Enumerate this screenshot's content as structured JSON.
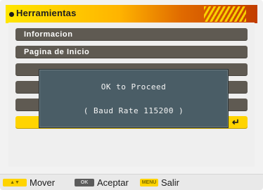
{
  "header": {
    "title": "Herramientas"
  },
  "menu": {
    "items": [
      {
        "label": "Informacion",
        "selected": false
      },
      {
        "label": "Pagina de Inicio",
        "selected": false
      },
      {
        "label": "",
        "selected": false
      },
      {
        "label": "",
        "selected": false
      },
      {
        "label": "",
        "selected": false
      },
      {
        "label": "",
        "selected": true
      }
    ],
    "enter_icon": "enter-return-icon"
  },
  "dialog": {
    "line1": "OK to Proceed",
    "line2": "( Baud Rate 115200 )"
  },
  "footer": {
    "move_label": "Mover",
    "accept_label": "Aceptar",
    "exit_label": "Salir",
    "move_key": "▲▼",
    "ok_key": "OK",
    "menu_key": "MENU"
  },
  "colors": {
    "header_gradient_start": "#ffe600",
    "header_gradient_end": "#c23d00",
    "menu_item_bg": "#5f5a52",
    "selected_bg": "#ffd400",
    "dialog_bg": "#4a5d66"
  }
}
